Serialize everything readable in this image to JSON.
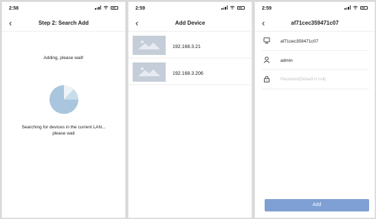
{
  "screen1": {
    "status_time": "2:58",
    "title": "Step 2: Search Add",
    "back_icon": "chevron-left-icon",
    "adding_text": "Adding, please wait!",
    "searching_line1": "Searching for devices in the current LAN...",
    "searching_line2": "please wait"
  },
  "screen2": {
    "status_time": "2:59",
    "title": "Add Device",
    "devices": [
      {
        "ip": "192.168.3.21"
      },
      {
        "ip": "192.168.3.206"
      }
    ]
  },
  "screen3": {
    "status_time": "2:59",
    "title": "af71cec359471c07",
    "device_id_value": "af71cec359471c07",
    "username_value": "admin",
    "password_placeholder": "Password(Default is null)",
    "add_label": "Add"
  },
  "colors": {
    "accent": "#7ea0d4",
    "radar": "#a9c6de",
    "thumb": "#c4cdd8"
  }
}
